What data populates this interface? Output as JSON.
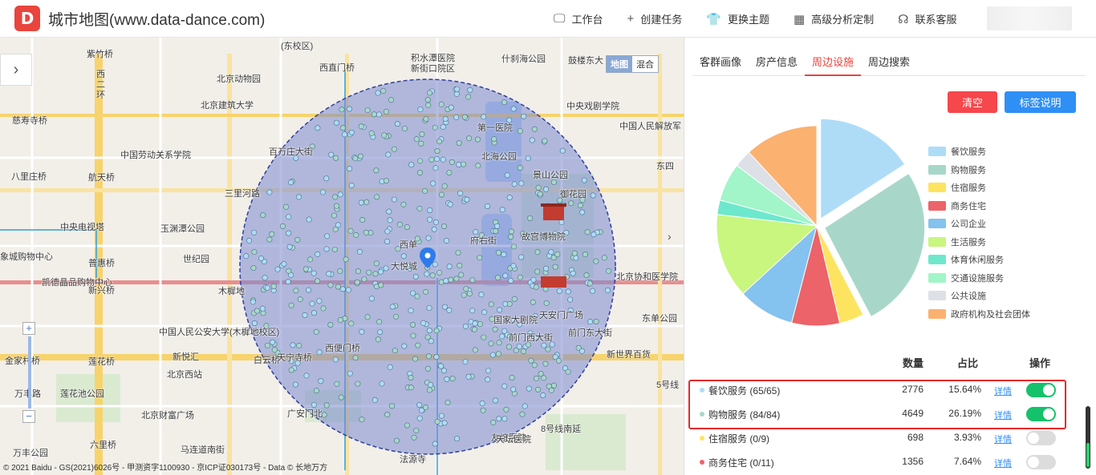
{
  "header": {
    "logo_letter": "D",
    "title": "城市地图(www.data-dance.com)",
    "nav": [
      {
        "label": "工作台",
        "icon": "monitor-icon",
        "glyph": "🖵"
      },
      {
        "label": "创建任务",
        "icon": "plus-icon",
        "glyph": "+"
      },
      {
        "label": "更换主题",
        "icon": "shirt-icon",
        "glyph": "👕"
      },
      {
        "label": "高级分析定制",
        "icon": "calendar-icon",
        "glyph": "▦"
      },
      {
        "label": "联系客服",
        "icon": "headset-icon",
        "glyph": "☊"
      }
    ]
  },
  "map": {
    "type_buttons": [
      "地图",
      "混合"
    ],
    "active_type": "地图",
    "collapse_glyph": "›",
    "zoom_in": "+",
    "zoom_out": "−",
    "copyright": "© 2021 Baidu - GS(2021)6026号 - 甲测资字1100930 - 京ICP证030173号 - Data © 长地万方",
    "labels": [
      "紫竹桥",
      "(东校区)",
      "积水潭医院",
      "新街口院区",
      "什刹海公园",
      "鼓楼东大",
      "西直门桥",
      "北京动物园",
      "北京建筑大学",
      "中央戏剧学院",
      "慈寿寺桥",
      "西",
      "二",
      "环",
      "中国人民解放军",
      "中国劳动关系学院",
      "百万庄大街",
      "第一医院",
      "北海公园",
      "景山公园",
      "东四",
      "八里庄桥",
      "航天桥",
      "三里河路",
      "故宫博物院",
      "御花园",
      "中央电视塔",
      "玉渊潭公园",
      "府右街",
      "象城购物中心",
      "世纪园",
      "普惠桥",
      "北京协和医学院",
      "凯德晶品购物中心",
      "新兴桥",
      "木樨地",
      "大悦城",
      "西单",
      "中国人民公安大学(木樨地校区)",
      "天安门广场",
      "国家大剧院",
      "东单公园",
      "金家村桥",
      "莲花桥",
      "新悦汇",
      "西便门桥",
      "前门西大街",
      "前门东大街",
      "北京西站",
      "新世界百货",
      "莲花池公园",
      "万丰路",
      "白云桥",
      "天宁寺桥",
      "友谊医院",
      "5号线",
      "北京财富广场",
      "广安门北",
      "8号线南延",
      "天坛医院",
      "六里桥",
      "马连道南街",
      "法源寺",
      "万丰公园"
    ]
  },
  "panel": {
    "tabs": [
      "客群画像",
      "房产信息",
      "周边设施",
      "周边搜索"
    ],
    "active_tab": "周边设施",
    "btn_clear": "清空",
    "btn_legend": "标签说明",
    "table_headers": {
      "count": "数量",
      "pct": "占比",
      "action": "操作"
    },
    "detail_label": "详情"
  },
  "chart_data": {
    "type": "pie",
    "legend_placement": "right",
    "categories": [
      "餐饮服务",
      "购物服务",
      "住宿服务",
      "商务住宅",
      "公司企业",
      "生活服务",
      "体育休闲服务",
      "交通设施服务",
      "公共设施",
      "政府机构及社会团体"
    ],
    "colors": [
      "#aedcf7",
      "#a8d7c9",
      "#fde460",
      "#ec6369",
      "#84c2ef",
      "#c8f67e",
      "#6ee8cd",
      "#a1f5c8",
      "#dde0e6",
      "#fbb170"
    ],
    "values": [
      15.64,
      26.19,
      3.93,
      7.64,
      9.0,
      13.5,
      2.3,
      6.1,
      2.8,
      11.7
    ],
    "exploded": [
      true,
      true,
      false,
      false,
      false,
      false,
      false,
      false,
      false,
      false
    ]
  },
  "rows": [
    {
      "name": "餐饮服务 (65/65)",
      "count": "2776",
      "pct": "15.64%",
      "on": true,
      "color": "#aedcf7"
    },
    {
      "name": "购物服务 (84/84)",
      "count": "4649",
      "pct": "26.19%",
      "on": true,
      "color": "#a8d7c9"
    },
    {
      "name": "住宿服务 (0/9)",
      "count": "698",
      "pct": "3.93%",
      "on": false,
      "color": "#fde460"
    },
    {
      "name": "商务住宅 (0/11)",
      "count": "1356",
      "pct": "7.64%",
      "on": false,
      "color": "#ec6369"
    }
  ]
}
